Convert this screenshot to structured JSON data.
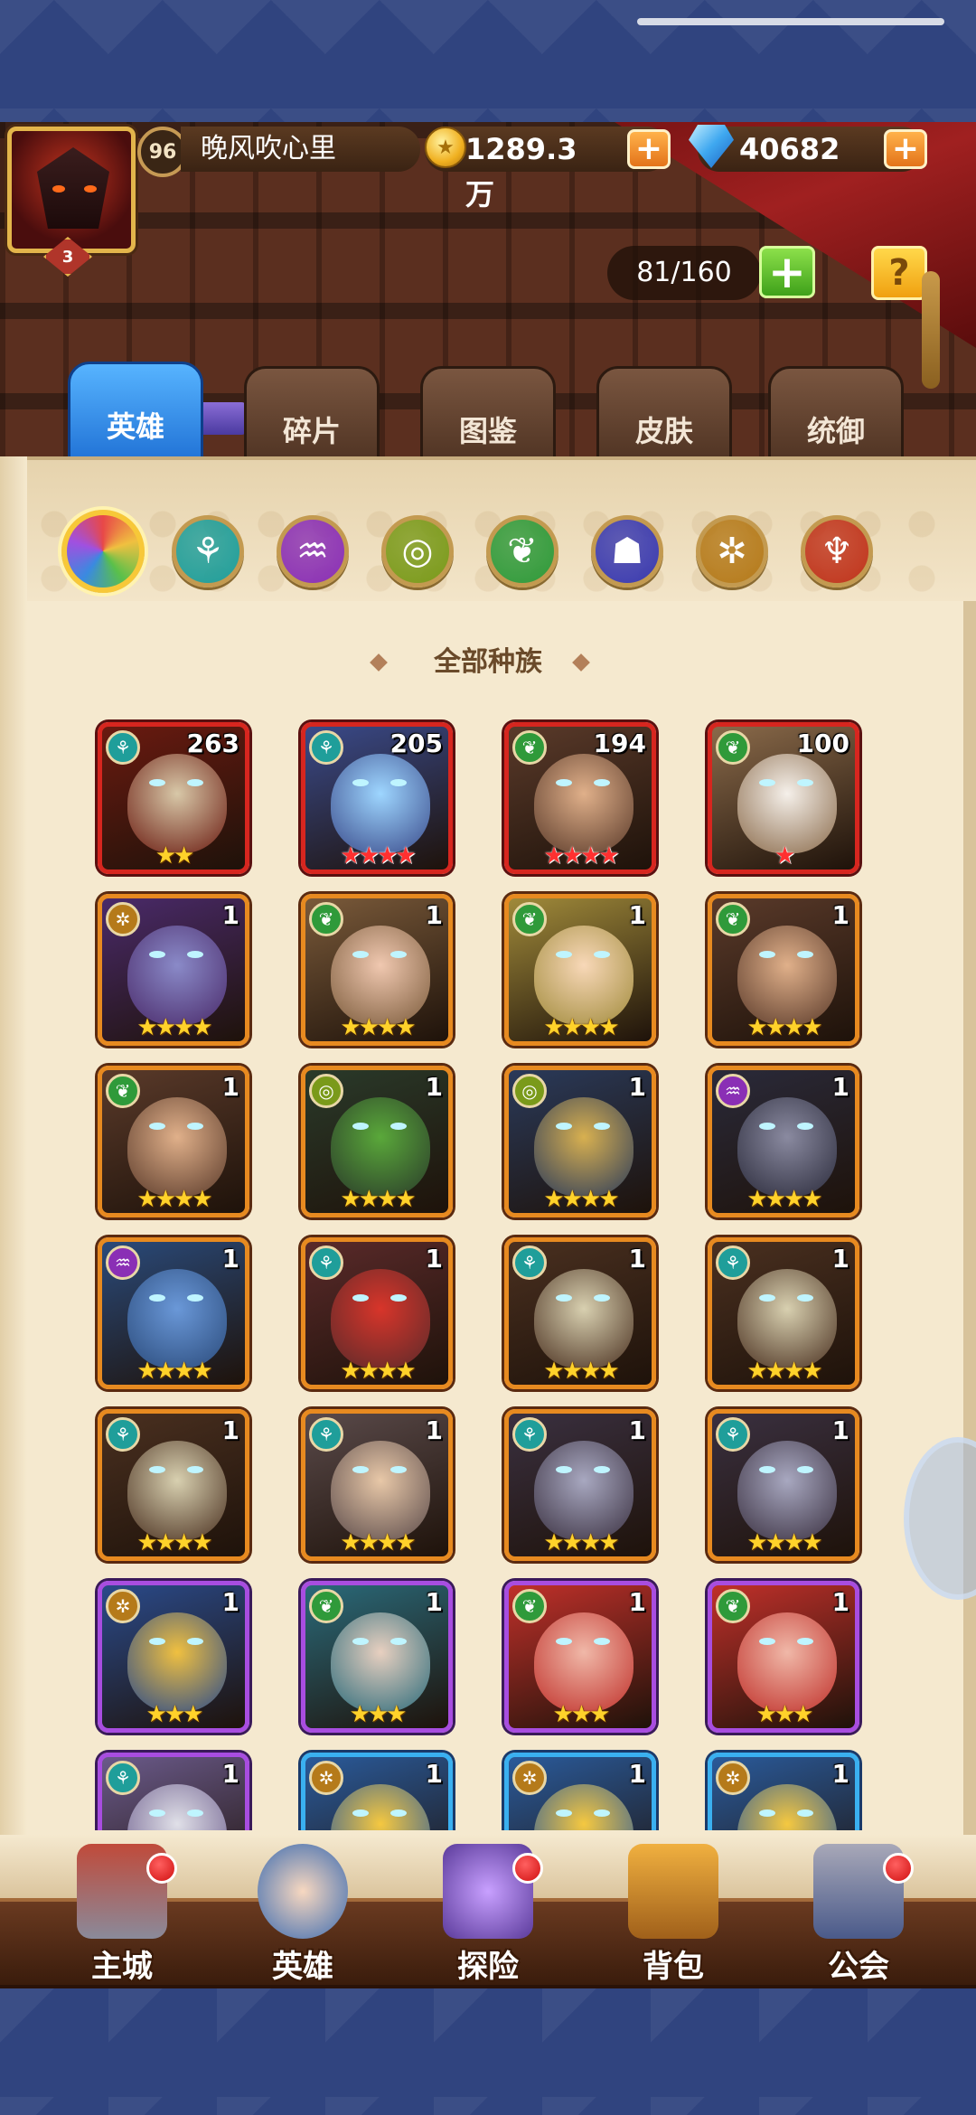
{
  "player": {
    "level": "96",
    "name": "晚风吹心里",
    "vip": "3",
    "gold": "1289.3万",
    "diamonds": "40682"
  },
  "hero_capacity": "81/160",
  "tabs": [
    {
      "label": "英雄",
      "active": true
    },
    {
      "label": "碎片",
      "active": false
    },
    {
      "label": "图鉴",
      "active": false
    },
    {
      "label": "皮肤",
      "active": false
    },
    {
      "label": "统御",
      "active": false
    }
  ],
  "race_filters": [
    {
      "icon": "rainbow-all-icon",
      "color": "#e84848",
      "selected": true
    },
    {
      "icon": "shadow-race-icon",
      "color": "#1f9e9a"
    },
    {
      "icon": "undead-race-icon",
      "color": "#8a2fb5"
    },
    {
      "icon": "fortress-race-icon",
      "color": "#7a9a1a"
    },
    {
      "icon": "forest-race-icon",
      "color": "#2f9a3a"
    },
    {
      "icon": "abyss-race-icon",
      "color": "#3a3ab0"
    },
    {
      "icon": "light-race-icon",
      "color": "#b57a1a"
    },
    {
      "icon": "dark-race-icon",
      "color": "#c0341c"
    }
  ],
  "section_title": "全部种族",
  "heroes": [
    {
      "level": "263",
      "stars": "★★",
      "star_color": "gold",
      "frame": "red",
      "race_color": "#1f9e9a",
      "skin": "#d8c8a8",
      "bg": "#6a1a10"
    },
    {
      "level": "205",
      "stars": "★★★★",
      "star_color": "red",
      "frame": "red",
      "race_color": "#1f9e9a",
      "skin": "#9ed6ff",
      "bg": "#3a4a8a"
    },
    {
      "level": "194",
      "stars": "★★★★",
      "star_color": "red",
      "frame": "red",
      "race_color": "#2f9a3a",
      "skin": "#e0b08a",
      "bg": "#5a3a2a"
    },
    {
      "level": "100",
      "stars": "★",
      "star_color": "red",
      "frame": "red",
      "race_color": "#2f9a3a",
      "skin": "#f5f0ea",
      "bg": "#8a6a4a"
    },
    {
      "level": "1",
      "stars": "★★★★",
      "star_color": "gold",
      "frame": "orange",
      "race_color": "#b57a1a",
      "skin": "#8a8ac8",
      "bg": "#4a2a6a"
    },
    {
      "level": "1",
      "stars": "★★★★",
      "star_color": "gold",
      "frame": "orange",
      "race_color": "#2f9a3a",
      "skin": "#f0c8b0",
      "bg": "#7a5a3a"
    },
    {
      "level": "1",
      "stars": "★★★★",
      "star_color": "gold",
      "frame": "orange",
      "race_color": "#2f9a3a",
      "skin": "#f8d8b8",
      "bg": "#a08a3a"
    },
    {
      "level": "1",
      "stars": "★★★★",
      "star_color": "gold",
      "frame": "orange",
      "race_color": "#2f9a3a",
      "skin": "#e0b08a",
      "bg": "#5a3a2a"
    },
    {
      "level": "1",
      "stars": "★★★★",
      "star_color": "gold",
      "frame": "orange",
      "race_color": "#2f9a3a",
      "skin": "#e0b08a",
      "bg": "#5a3a2a"
    },
    {
      "level": "1",
      "stars": "★★★★",
      "star_color": "gold",
      "frame": "orange",
      "race_color": "#7a9a1a",
      "skin": "#5aa83a",
      "bg": "#2a3a2a"
    },
    {
      "level": "1",
      "stars": "★★★★",
      "star_color": "gold",
      "frame": "orange",
      "race_color": "#7a9a1a",
      "skin": "#d8b050",
      "bg": "#2a3a5a"
    },
    {
      "level": "1",
      "stars": "★★★★",
      "star_color": "gold",
      "frame": "orange",
      "race_color": "#8a2fb5",
      "skin": "#8a8aa0",
      "bg": "#2a2a3a"
    },
    {
      "level": "1",
      "stars": "★★★★",
      "star_color": "gold",
      "frame": "orange",
      "race_color": "#8a2fb5",
      "skin": "#6a98d8",
      "bg": "#2a4a7a"
    },
    {
      "level": "1",
      "stars": "★★★★",
      "star_color": "gold",
      "frame": "orange",
      "race_color": "#1f9e9a",
      "skin": "#d8352a",
      "bg": "#5a2a2a"
    },
    {
      "level": "1",
      "stars": "★★★★",
      "star_color": "gold",
      "frame": "orange",
      "race_color": "#1f9e9a",
      "skin": "#d8d0b0",
      "bg": "#4a3020"
    },
    {
      "level": "1",
      "stars": "★★★★",
      "star_color": "gold",
      "frame": "orange",
      "race_color": "#1f9e9a",
      "skin": "#d8d0b0",
      "bg": "#4a3020"
    },
    {
      "level": "1",
      "stars": "★★★★",
      "star_color": "gold",
      "frame": "orange",
      "race_color": "#1f9e9a",
      "skin": "#d8d0b0",
      "bg": "#4a3020"
    },
    {
      "level": "1",
      "stars": "★★★★",
      "star_color": "gold",
      "frame": "orange",
      "race_color": "#1f9e9a",
      "skin": "#e8c8a8",
      "bg": "#5a4a4a"
    },
    {
      "level": "1",
      "stars": "★★★★",
      "star_color": "gold",
      "frame": "orange",
      "race_color": "#1f9e9a",
      "skin": "#a8a8c0",
      "bg": "#3a3040"
    },
    {
      "level": "1",
      "stars": "★★★★",
      "star_color": "gold",
      "frame": "orange",
      "race_color": "#1f9e9a",
      "skin": "#a8a8c0",
      "bg": "#3a3040"
    },
    {
      "level": "1",
      "stars": "★★★",
      "star_color": "gold",
      "frame": "purple",
      "race_color": "#b57a1a",
      "skin": "#f0c040",
      "bg": "#2a4a8a"
    },
    {
      "level": "1",
      "stars": "★★★",
      "star_color": "gold",
      "frame": "purple",
      "race_color": "#2f9a3a",
      "skin": "#e8d0c0",
      "bg": "#2a6a7a"
    },
    {
      "level": "1",
      "stars": "★★★",
      "star_color": "gold",
      "frame": "purple",
      "race_color": "#2f9a3a",
      "skin": "#f0b8a8",
      "bg": "#c0302a"
    },
    {
      "level": "1",
      "stars": "★★★",
      "star_color": "gold",
      "frame": "purple",
      "race_color": "#2f9a3a",
      "skin": "#f0b8a8",
      "bg": "#c0302a"
    },
    {
      "level": "1",
      "stars": "",
      "star_color": "gold",
      "frame": "purple",
      "race_color": "#1f9e9a",
      "skin": "#e0e0e8",
      "bg": "#6a5a8a"
    },
    {
      "level": "1",
      "stars": "",
      "star_color": "gold",
      "frame": "blue",
      "race_color": "#b57a1a",
      "skin": "#f5c840",
      "bg": "#2a5a9a"
    },
    {
      "level": "1",
      "stars": "",
      "star_color": "gold",
      "frame": "blue",
      "race_color": "#b57a1a",
      "skin": "#f5c840",
      "bg": "#2a5a9a"
    },
    {
      "level": "1",
      "stars": "",
      "star_color": "gold",
      "frame": "blue",
      "race_color": "#b57a1a",
      "skin": "#f5c840",
      "bg": "#2a5a9a"
    }
  ],
  "bottom_nav": [
    {
      "label": "主城",
      "icon": "castle-icon",
      "badge": true
    },
    {
      "label": "英雄",
      "icon": "hero-portrait-icon",
      "badge": false
    },
    {
      "label": "探险",
      "icon": "portal-icon",
      "badge": true
    },
    {
      "label": "背包",
      "icon": "backpack-icon",
      "badge": false
    },
    {
      "label": "公会",
      "icon": "guild-tower-icon",
      "badge": true
    }
  ]
}
